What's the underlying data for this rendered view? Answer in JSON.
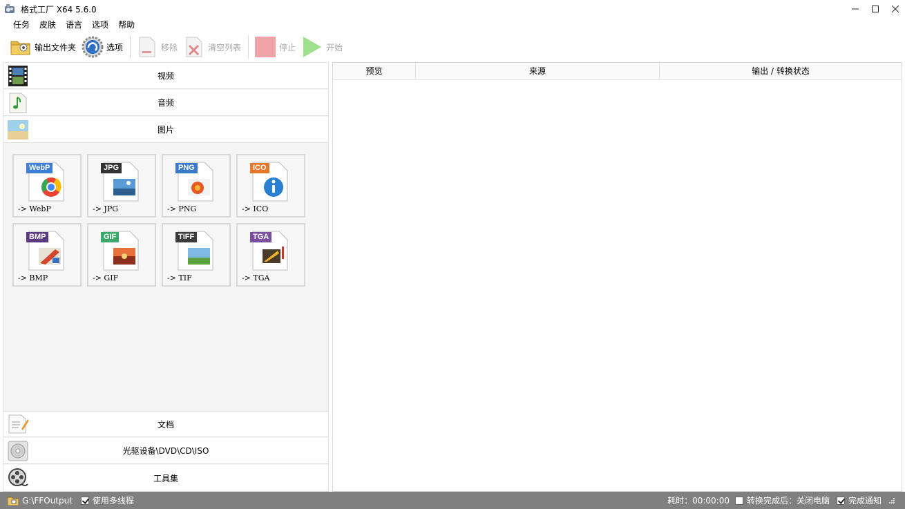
{
  "window": {
    "title": "格式工厂 X64 5.6.0"
  },
  "menu": [
    "任务",
    "皮肤",
    "语言",
    "选项",
    "帮助"
  ],
  "toolbar": {
    "output_folder": "输出文件夹",
    "options": "选项",
    "remove": "移除",
    "clear_list": "清空列表",
    "stop": "停止",
    "start": "开始"
  },
  "categories": {
    "video": "视频",
    "audio": "音频",
    "image": "图片",
    "document": "文档",
    "rom": "光驱设备\\DVD\\CD\\ISO",
    "tools": "工具集"
  },
  "image_formats": [
    {
      "badge": "WebP",
      "label": "-> WebP",
      "color": "#3d7fd6"
    },
    {
      "badge": "JPG",
      "label": "-> JPG",
      "color": "#333333"
    },
    {
      "badge": "PNG",
      "label": "-> PNG",
      "color": "#3a78c9"
    },
    {
      "badge": "ICO",
      "label": "-> ICO",
      "color": "#e8762c"
    },
    {
      "badge": "BMP",
      "label": "-> BMP",
      "color": "#5b3a82"
    },
    {
      "badge": "GIF",
      "label": "-> GIF",
      "color": "#3aa96a"
    },
    {
      "badge": "TIFF",
      "label": "-> TIF",
      "color": "#3b3b3b"
    },
    {
      "badge": "TGA",
      "label": "-> TGA",
      "color": "#7a4f9e"
    }
  ],
  "table": {
    "columns": [
      "预览",
      "来源",
      "输出 / 转换状态"
    ]
  },
  "status": {
    "output_path": "G:\\FFOutput",
    "multithread_label": "使用多线程",
    "multithread_checked": true,
    "elapsed": "耗时：00:00:00",
    "after_done_label": "转换完成后：关闭电脑",
    "after_done_checked": false,
    "notify_label": "完成通知",
    "notify_checked": true
  }
}
